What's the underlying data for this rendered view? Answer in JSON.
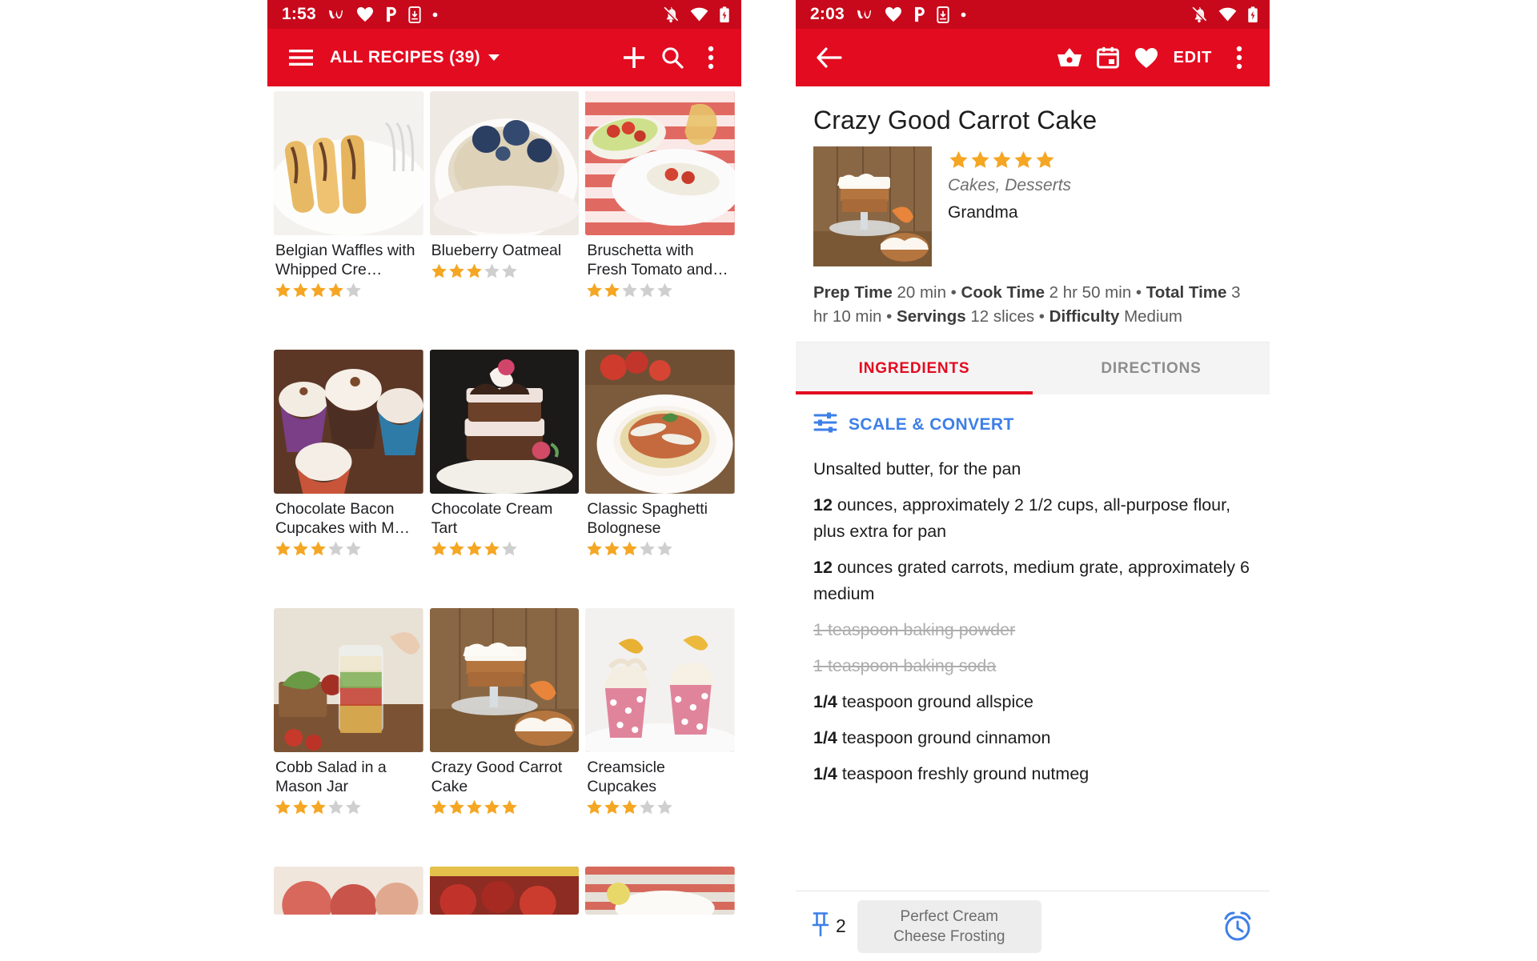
{
  "colors": {
    "status_bar": "#c8081b",
    "app_bar": "#e30b20",
    "accent": "#e30b20",
    "link_blue": "#3d7fe8",
    "star_gold": "#f5a623",
    "star_gray": "#cfcfcf"
  },
  "left_screen": {
    "status_bar": {
      "time": "1:53",
      "icons_left": [
        "w-app-icon",
        "heart-icon",
        "p-app-icon",
        "phone-download-icon",
        "dot-icon"
      ],
      "icons_right": [
        "notifications-off-icon",
        "wifi-icon",
        "battery-icon"
      ]
    },
    "app_bar": {
      "menu_icon": "hamburger-menu-icon",
      "title": "ALL RECIPES (39)",
      "dropdown_icon": "chevron-down-icon",
      "add_icon": "plus-icon",
      "search_icon": "search-icon",
      "overflow_icon": "more-vert-icon"
    },
    "recipes": [
      {
        "title": "Belgian Waffles with Whipped Cre…",
        "rating": 4,
        "image": "belgian-waffles-photo"
      },
      {
        "title": "Blueberry Oatmeal",
        "rating": 3,
        "image": "blueberry-oatmeal-photo"
      },
      {
        "title": "Bruschetta with Fresh Tomato and…",
        "rating": 2,
        "image": "bruschetta-photo"
      },
      {
        "title": "Chocolate Bacon Cupcakes with M…",
        "rating": 3,
        "image": "chocolate-bacon-cupcakes-photo"
      },
      {
        "title": "Chocolate Cream Tart",
        "rating": 4,
        "image": "chocolate-cream-tart-photo"
      },
      {
        "title": "Classic Spaghetti Bolognese",
        "rating": 3,
        "image": "spaghetti-bolognese-photo"
      },
      {
        "title": "Cobb Salad in a Mason Jar",
        "rating": 3,
        "image": "cobb-salad-mason-jar-photo"
      },
      {
        "title": "Crazy Good Carrot Cake",
        "rating": 5,
        "image": "carrot-cake-photo"
      },
      {
        "title": "Creamsicle Cupcakes",
        "rating": 3,
        "image": "creamsicle-cupcakes-photo"
      }
    ],
    "partial_row_images": [
      "apples-photo",
      "strawberries-photo",
      "picnic-photo"
    ]
  },
  "right_screen": {
    "status_bar": {
      "time": "2:03",
      "icons_left": [
        "w-app-icon",
        "heart-icon",
        "p-app-icon",
        "phone-download-icon",
        "dot-icon"
      ],
      "icons_right": [
        "notifications-off-icon",
        "wifi-icon",
        "battery-icon"
      ]
    },
    "app_bar": {
      "back_icon": "arrow-back-icon",
      "basket_icon": "shopping-basket-icon",
      "calendar_icon": "calendar-icon",
      "favorite_icon": "heart-icon",
      "edit_label": "EDIT",
      "overflow_icon": "more-vert-icon"
    },
    "recipe": {
      "title": "Crazy Good Carrot Cake",
      "hero_image": "carrot-cake-photo",
      "rating": 5,
      "max_rating": 5,
      "categories": "Cakes, Desserts",
      "author": "Grandma",
      "meta": [
        {
          "label": "Prep Time",
          "value": "20 min"
        },
        {
          "label": "Cook Time",
          "value": "2 hr 50 min"
        },
        {
          "label": "Total Time",
          "value": "3 hr 10 min"
        },
        {
          "label": "Servings",
          "value": "12 slices"
        },
        {
          "label": "Difficulty",
          "value": "Medium"
        }
      ],
      "meta_separator": "•"
    },
    "tabs": [
      {
        "label": "INGREDIENTS",
        "active": true
      },
      {
        "label": "DIRECTIONS",
        "active": false
      }
    ],
    "scale_convert": {
      "icon": "tune-sliders-icon",
      "label": "SCALE & CONVERT"
    },
    "ingredients": [
      {
        "amount": "",
        "text": "Unsalted butter, for the pan",
        "checked": false
      },
      {
        "amount": "12",
        "text": " ounces, approximately 2 1/2 cups, all-purpose flour, plus extra for pan",
        "checked": false
      },
      {
        "amount": "12",
        "text": " ounces grated carrots, medium grate, approximately 6 medium",
        "checked": false
      },
      {
        "amount": "1",
        "text": " teaspoon baking powder",
        "checked": true
      },
      {
        "amount": "1",
        "text": " teaspoon baking soda",
        "checked": true
      },
      {
        "amount": "1/4",
        "text": " teaspoon ground allspice",
        "checked": false
      },
      {
        "amount": "1/4",
        "text": " teaspoon ground cinnamon",
        "checked": false
      },
      {
        "amount": "1/4",
        "text": " teaspoon freshly ground nutmeg",
        "checked": false
      }
    ],
    "bottom_bar": {
      "pin_icon": "pin-icon",
      "pin_count": "2",
      "linked_recipe_chip": "Perfect Cream Cheese Frosting",
      "timer_icon": "alarm-clock-icon"
    }
  }
}
